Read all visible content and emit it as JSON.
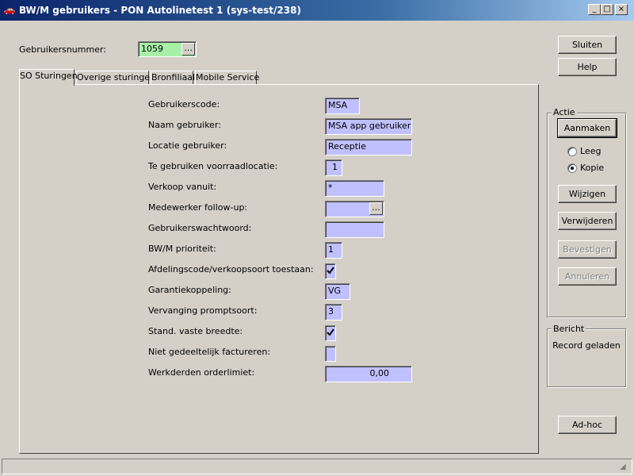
{
  "window": {
    "title": "BW/M gebruikers - PON Autolinetest 1 (sys-test/238)",
    "controls": {
      "minimize": "_",
      "maximize": "□",
      "close": "×"
    }
  },
  "header": {
    "user_number_label": "Gebruikersnummer:",
    "user_number_value": "1059",
    "lookup_label": "..."
  },
  "tabs": [
    {
      "label": "SO Sturingen",
      "active": true
    },
    {
      "label": "Overige sturingen",
      "active": false
    },
    {
      "label": "Bronfiliaal",
      "active": false
    },
    {
      "label": "Mobile Service",
      "active": false
    }
  ],
  "form": {
    "user_code": {
      "label": "Gebruikerscode:",
      "value": "MSA"
    },
    "user_name": {
      "label": "Naam gebruiker:",
      "value": "MSA app gebruiker"
    },
    "user_location": {
      "label": "Locatie gebruiker:",
      "value": "Receptie"
    },
    "stock_location": {
      "label": "Te gebruiken voorraadlocatie:",
      "value": "1"
    },
    "sale_from": {
      "label": "Verkoop vanuit:",
      "value": "*"
    },
    "followup_employee": {
      "label": "Medewerker follow-up:",
      "value": "",
      "lookup": "..."
    },
    "password": {
      "label": "Gebruikerswachtwoord:",
      "value": ""
    },
    "priority": {
      "label": "BW/M prioriteit:",
      "value": "1"
    },
    "dept_code_allowed": {
      "label": "Afdelingscode/verkoopsoort toestaan:",
      "checked": true
    },
    "warranty_link": {
      "label": "Garantiekoppeling:",
      "value": "VG"
    },
    "replacement_prompt": {
      "label": "Vervanging promptsoort:",
      "value": "3"
    },
    "fixed_width": {
      "label": "Stand. vaste breedte:",
      "checked": true
    },
    "no_partial_invoice": {
      "label": "Niet gedeeltelijk factureren:",
      "checked": false
    },
    "third_party_limit": {
      "label": "Werkderden orderlimiet:",
      "value": "0,00"
    }
  },
  "buttons": {
    "close": "Sluiten",
    "help": "Help",
    "adhoc": "Ad-hoc"
  },
  "action_group": {
    "title": "Actie",
    "create": "Aanmaken",
    "radio_empty": "Leeg",
    "radio_copy": "Kopie",
    "selected_radio": "Kopie",
    "modify": "Wijzigen",
    "delete": "Verwijderen",
    "confirm": "Bevestigen",
    "cancel": "Annuleren"
  },
  "message_group": {
    "title": "Bericht",
    "text": "Record geladen"
  },
  "colors": {
    "field_bg": "#c0c0ff",
    "lookup_field_bg": "#a8f0a8",
    "titlebar": "#0a246a"
  }
}
